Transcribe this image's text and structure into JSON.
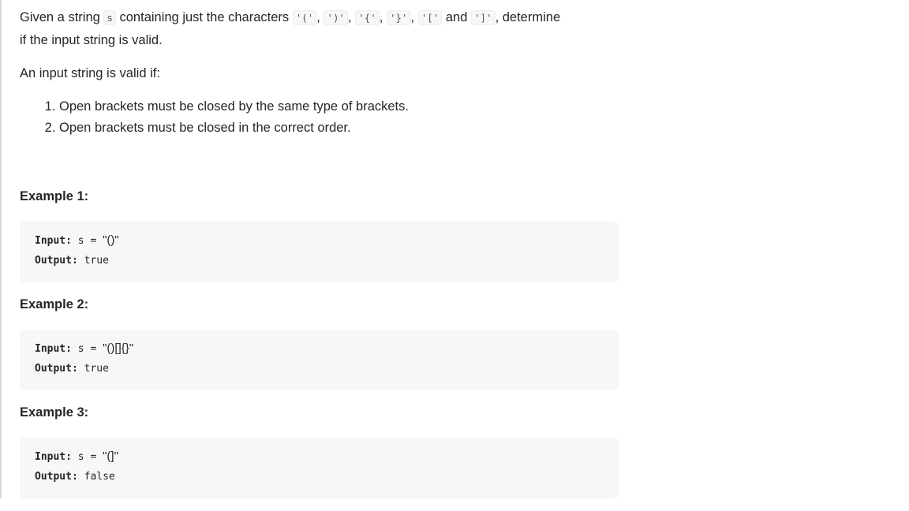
{
  "description": {
    "intro_part1": "Given a string ",
    "var_s": "s",
    "intro_part2": " containing just the characters ",
    "chars": [
      "'('",
      "')'",
      "'{'",
      "'}'",
      "'['",
      "']'"
    ],
    "sep_comma": ", ",
    "sep_and": " and ",
    "intro_part3": ", determine",
    "intro_line2": "if the input string is valid.",
    "valid_if": "An input string is valid if:",
    "rules": [
      "Open brackets must be closed by the same type of brackets.",
      "Open brackets must be closed in the correct order."
    ]
  },
  "examples": [
    {
      "title": "Example 1:",
      "input_label": "Input:",
      "input_var": "s =",
      "input_value": "\"()\"",
      "output_label": "Output:",
      "output_value": "true"
    },
    {
      "title": "Example 2:",
      "input_label": "Input:",
      "input_var": "s =",
      "input_value": "\"()[]{}\"",
      "output_label": "Output:",
      "output_value": "true"
    },
    {
      "title": "Example 3:",
      "input_label": "Input:",
      "input_var": "s =",
      "input_value": "\"(]\"",
      "output_label": "Output:",
      "output_value": "false"
    }
  ]
}
